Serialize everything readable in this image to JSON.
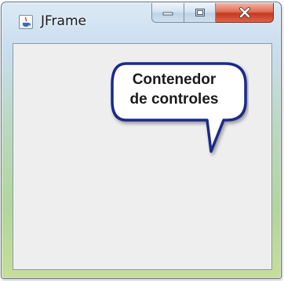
{
  "window": {
    "title": "JFrame",
    "icon": "java-cup-icon",
    "controls": {
      "minimize": "minimize-icon",
      "maximize": "maximize-icon",
      "close": "close-icon"
    }
  },
  "callout": {
    "line1": "Contenedor",
    "line2": "de controles",
    "border_color": "#1e2a8a",
    "fill_color": "#ffffff"
  },
  "colors": {
    "client_area": "#eeeeee",
    "close_button": "#c8391f"
  }
}
